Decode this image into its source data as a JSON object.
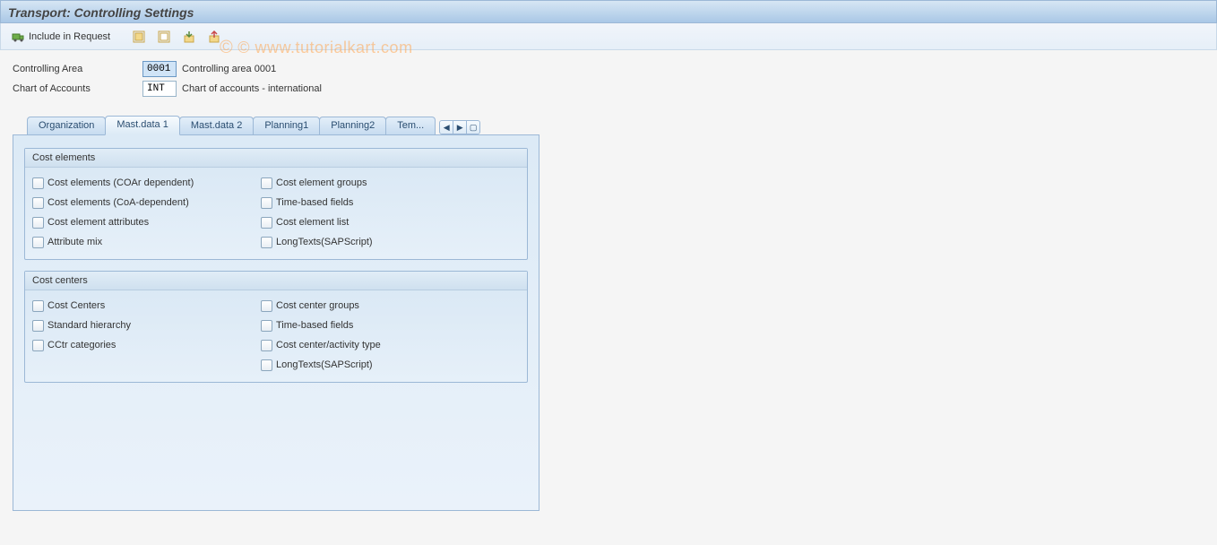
{
  "title": "Transport: Controlling Settings",
  "toolbar": {
    "include_label": "Include in Request"
  },
  "watermark": "© www.tutorialkart.com",
  "form": {
    "controlling_area": {
      "label": "Controlling Area",
      "value": "0001",
      "desc": "Controlling area 0001"
    },
    "chart_of_accounts": {
      "label": "Chart of Accounts",
      "value": "INT",
      "desc": "Chart of accounts - international"
    }
  },
  "tabs": [
    {
      "label": "Organization"
    },
    {
      "label": "Mast.data 1"
    },
    {
      "label": "Mast.data 2"
    },
    {
      "label": "Planning1"
    },
    {
      "label": "Planning2"
    },
    {
      "label": "Tem..."
    }
  ],
  "active_tab_index": 1,
  "groups": {
    "cost_elements": {
      "title": "Cost elements",
      "rows": [
        {
          "left": "Cost elements (COAr dependent)",
          "right": "Cost element groups"
        },
        {
          "left": "Cost elements (CoA-dependent)",
          "right": "Time-based fields"
        },
        {
          "left": "Cost element attributes",
          "right": "Cost element list"
        },
        {
          "left": "Attribute mix",
          "right": "LongTexts(SAPScript)"
        }
      ]
    },
    "cost_centers": {
      "title": "Cost centers",
      "rows": [
        {
          "left": "Cost Centers",
          "right": "Cost center groups"
        },
        {
          "left": "Standard hierarchy",
          "right": "Time-based fields"
        },
        {
          "left": "CCtr categories",
          "right": "Cost center/activity type"
        },
        {
          "left": "",
          "right": "LongTexts(SAPScript)"
        }
      ]
    }
  }
}
